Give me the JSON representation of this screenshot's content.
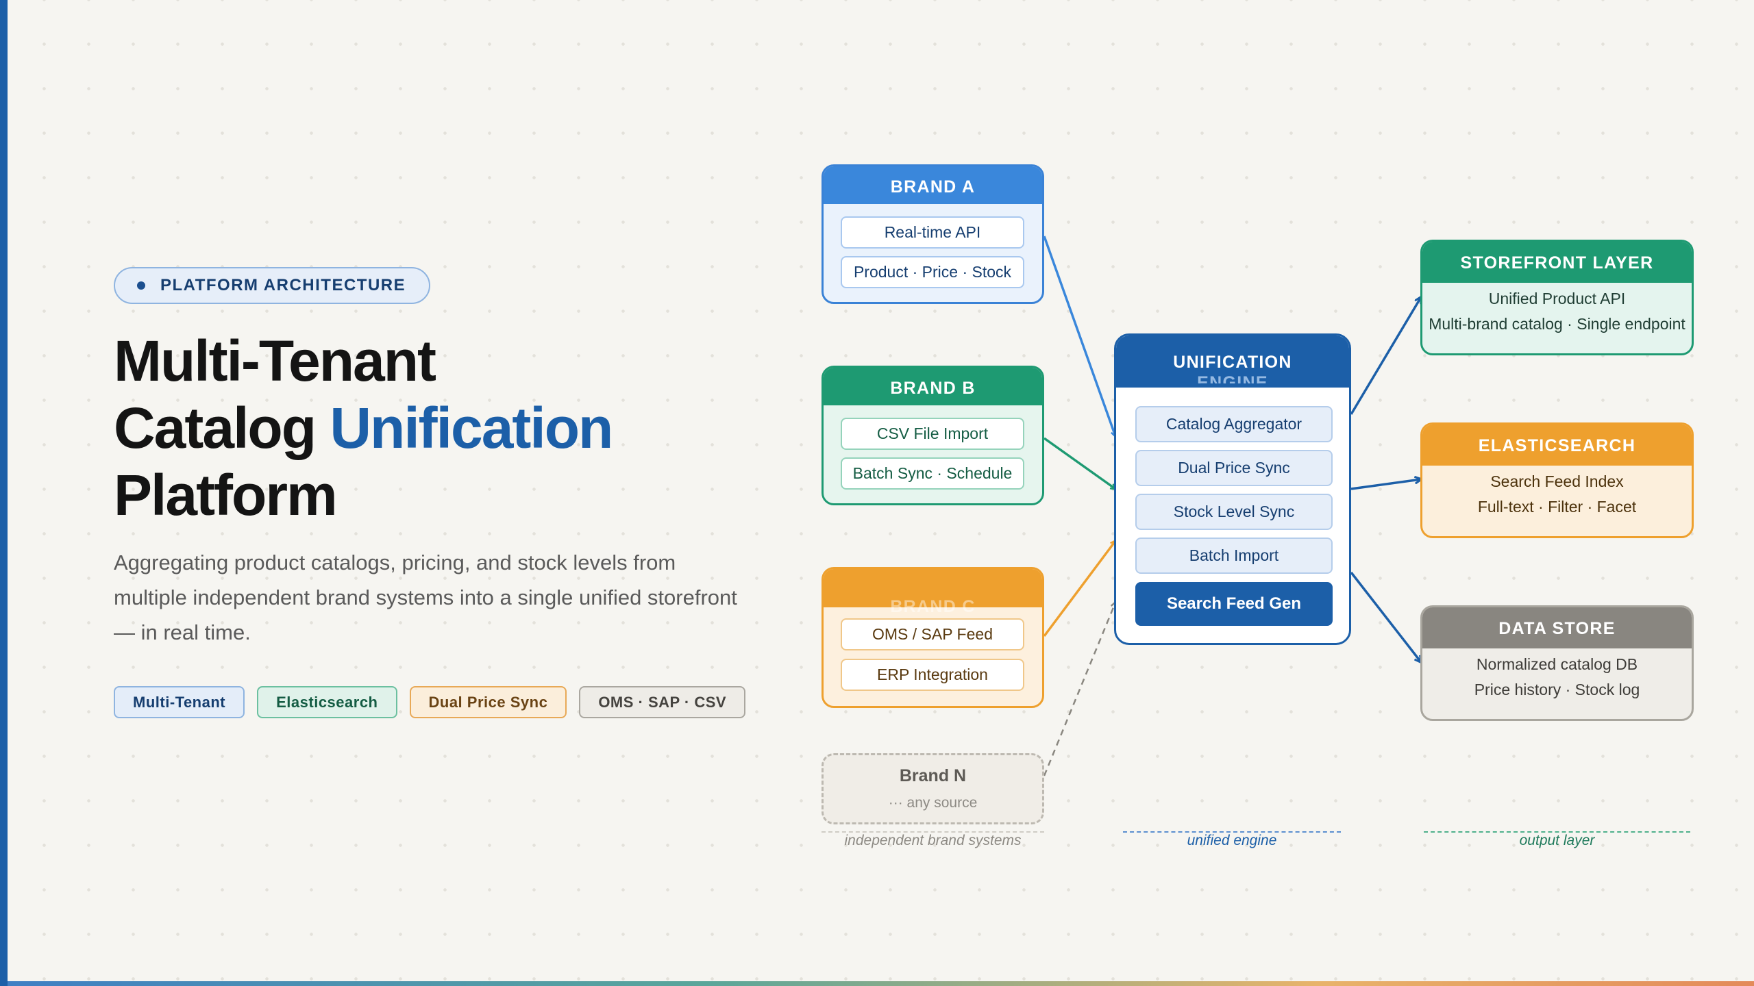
{
  "hero": {
    "eyebrow": "PLATFORM ARCHITECTURE",
    "title_line1": "Multi-Tenant",
    "title_line2_a": "Catalog ",
    "title_line2_b": "Unification",
    "title_line3": "Platform",
    "subtitle": "Aggregating product catalogs, pricing, and stock levels from multiple independent brand systems into a single unified storefront — in real time.",
    "tags": [
      "Multi-Tenant",
      "Elasticsearch",
      "Dual Price Sync",
      "OMS · SAP · CSV"
    ]
  },
  "sources": {
    "brand_a": {
      "title": "BRAND A",
      "items": [
        "Real-time API",
        "Product · Price · Stock"
      ]
    },
    "brand_b": {
      "title": "BRAND B",
      "items": [
        "CSV File Import",
        "Batch Sync · Schedule"
      ]
    },
    "brand_c": {
      "title": "BRAND C",
      "items": [
        "OMS / SAP Feed",
        "ERP Integration"
      ]
    },
    "brand_n": {
      "title": "Brand N",
      "subtitle": "··· any source"
    }
  },
  "engine": {
    "title_line1": "UNIFICATION",
    "title_line2": "ENGINE",
    "items": [
      "Catalog Aggregator",
      "Dual Price Sync",
      "Stock Level Sync",
      "Batch Import"
    ],
    "primary": "Search Feed Gen"
  },
  "outputs": {
    "storefront": {
      "title": "STOREFRONT LAYER",
      "lines": [
        "Unified Product API",
        "Multi-brand catalog · Single endpoint"
      ]
    },
    "elasticsearch": {
      "title": "ELASTICSEARCH",
      "lines": [
        "Search Feed Index",
        "Full-text · Filter · Facet"
      ]
    },
    "datastore": {
      "title": "DATA STORE",
      "lines": [
        "Normalized catalog DB",
        "Price history · Stock log"
      ]
    }
  },
  "column_labels": [
    "independent brand systems",
    "unified engine",
    "output layer"
  ],
  "colors": {
    "primary_blue": "#1c5fa8",
    "brand_a_blue": "#3a87db",
    "green": "#1e9a72",
    "orange": "#eea02e",
    "gray": "#898680"
  }
}
